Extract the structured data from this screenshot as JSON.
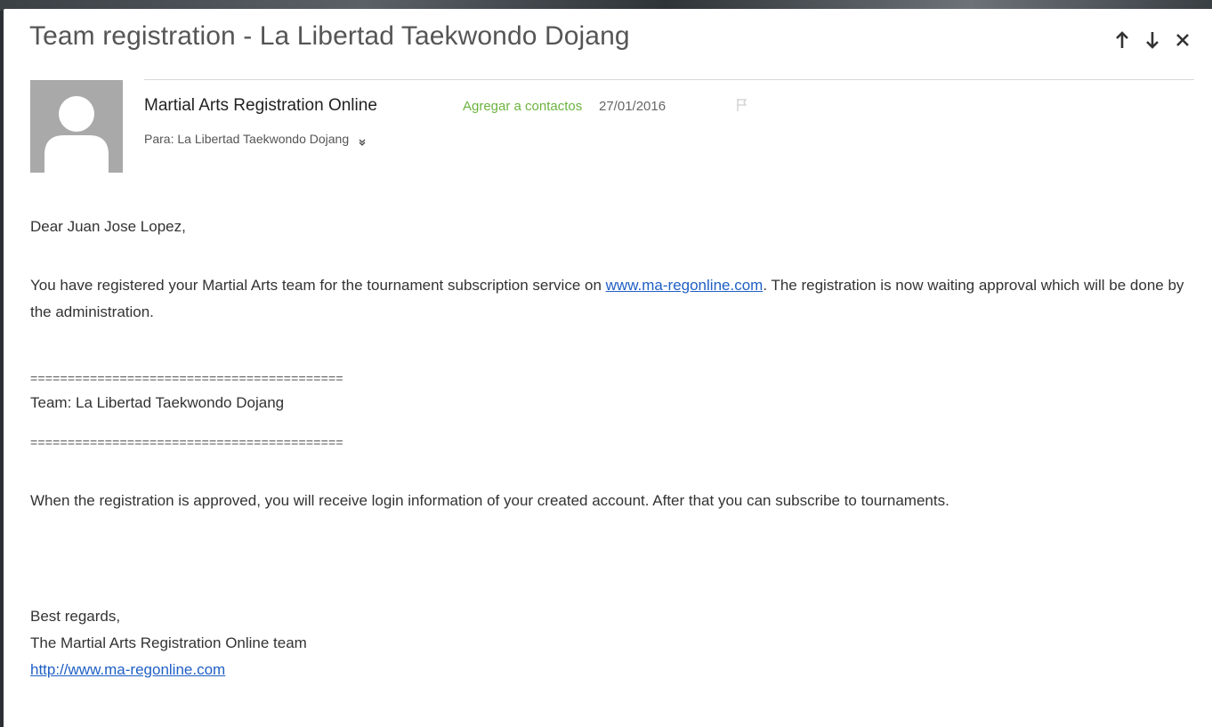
{
  "email": {
    "subject": "Team registration - La Libertad Taekwondo Dojang",
    "nav": {
      "up_icon": "arrow-up-icon",
      "down_icon": "arrow-down-icon",
      "close_icon": "close-icon"
    },
    "header": {
      "sender_name": "Martial Arts Registration Online",
      "add_contact_label": "Agregar a contactos",
      "date": "27/01/2016",
      "flag_icon": "flag-icon",
      "to_line": "Para: La Libertad Taekwondo Dojang",
      "expand_icon": "chevron-down-icon"
    },
    "body": {
      "greeting": "Dear Juan Jose Lopez,",
      "para1_before": "You have registered your Martial Arts team for the tournament subscription service on ",
      "para1_link": "www.ma-regonline.com",
      "para1_after": ". The registration is now waiting approval which will be done by the administration.",
      "separator": "==========================================",
      "team_line": "Team: La Libertad Taekwondo Dojang",
      "para2": "When the registration is approved, you will receive login information of your created account. After that you can subscribe to tournaments.",
      "closing": "Best regards,",
      "signature": "The Martial Arts Registration Online team",
      "signature_link": "http://www.ma-regonline.com"
    }
  },
  "colors": {
    "add_contact": "#6cb33f",
    "link": "#1f5fc5",
    "avatar_bg": "#a9a9a9"
  }
}
